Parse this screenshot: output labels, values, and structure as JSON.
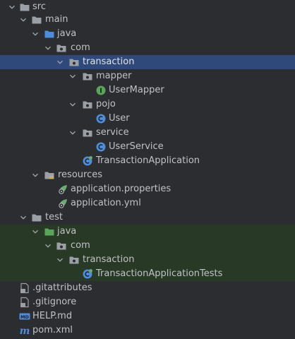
{
  "colors": {
    "background": "#2b2d30",
    "selection": "#2f4a7a",
    "test_highlight": "#283a25",
    "text": "#bfc2c6",
    "folder": "#9aa0a6",
    "folder_source": "#4f8dd8",
    "folder_test": "#5ca35c",
    "class_icon": "#4f8dd8",
    "interface_icon": "#5ca35c",
    "spring_icon": "#6aab73"
  },
  "tree": {
    "src": "src",
    "main": "main",
    "main_java": "java",
    "main_com": "com",
    "main_transaction": "transaction",
    "mapper": "mapper",
    "user_mapper": "UserMapper",
    "pojo": "pojo",
    "user": "User",
    "service": "service",
    "user_service": "UserService",
    "transaction_application": "TransactionApplication",
    "resources": "resources",
    "application_properties": "application.properties",
    "application_yml": "application.yml",
    "test": "test",
    "test_java": "java",
    "test_com": "com",
    "test_transaction": "transaction",
    "transaction_application_tests": "TransactionApplicationTests",
    "gitattributes": ".gitattributes",
    "gitignore": ".gitignore",
    "help_md": "HELP.md",
    "pom_xml": "pom.xml"
  },
  "icons": {
    "folder": "folder-icon",
    "source_folder": "source-folder-icon",
    "test_folder": "test-folder-icon",
    "package": "package-icon",
    "resources_folder": "resources-folder-icon",
    "class": "class-icon",
    "interface": "interface-icon",
    "spring_config": "spring-config-icon",
    "git_file": "git-file-icon",
    "markdown": "markdown-icon",
    "maven": "maven-icon"
  }
}
